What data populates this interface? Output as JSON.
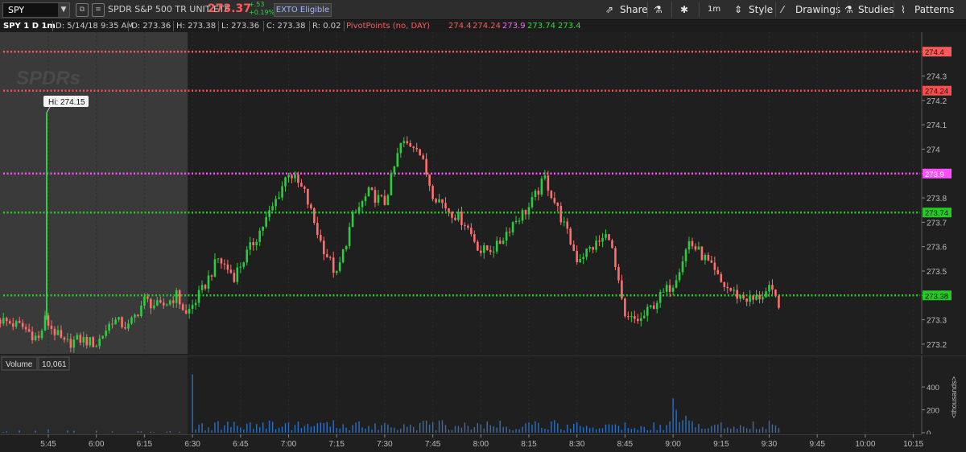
{
  "header": {
    "symbol": "SPY",
    "company": "SPDR S&P 500 TR UNIT ETF",
    "last": "273.37",
    "change": "+.53",
    "change_pct": "+0.19%",
    "eligibility": "EXTO Eligible",
    "share": "Share",
    "timeframe": "1m",
    "style": "Style",
    "drawings": "Drawings",
    "studies": "Studies",
    "patterns": "Patterns"
  },
  "info": {
    "chart_label": "SPY 1 D 1m",
    "date": "D: 5/14/18 9:35 AM",
    "open": "O: 273.36",
    "high": "H: 273.38",
    "low": "L: 273.36",
    "close": "C: 273.38",
    "range": "R: 0.02",
    "study": "PivotPoints (no, DAY)",
    "pivots": [
      "274.4",
      "274.24",
      "273.9",
      "273.74",
      "273.4"
    ]
  },
  "colors": {
    "background": "#1f1f1f",
    "premarket": "#3a3a3a",
    "up": "#2ecc40",
    "down": "#ff6e6e",
    "volume": "#2f6fbf",
    "r2": "#ff5a5a",
    "r1": "#ff4d4d",
    "pp": "#ff4dff",
    "s1": "#22cc22",
    "s2": "#22cc22"
  },
  "watermark": "SPDRs",
  "chart_data": {
    "type": "candlestick",
    "title": "SPY 1 D 1m",
    "x_ticks": [
      "5:45",
      "6:00",
      "6:15",
      "6:30",
      "6:45",
      "7:00",
      "7:15",
      "7:30",
      "7:45",
      "8:00",
      "8:15",
      "8:30",
      "8:45",
      "9:00",
      "9:15",
      "9:30",
      "9:45",
      "10:00",
      "10:15"
    ],
    "y_ticks": [
      "274.4",
      "274.3",
      "274.2",
      "274.1",
      "274",
      "273.9",
      "273.8",
      "273.7",
      "273.6",
      "273.5",
      "273.4",
      "273.3",
      "273.2"
    ],
    "ylim": [
      273.16,
      274.48
    ],
    "premarket_end": "6:30",
    "high_label": "Hi: 274.15",
    "pivot_lines": [
      {
        "name": "R2",
        "value": 274.4,
        "label": "274.4"
      },
      {
        "name": "R1",
        "value": 274.24,
        "label": "274.24"
      },
      {
        "name": "PP",
        "value": 273.9,
        "label": "273.9"
      },
      {
        "name": "S1",
        "value": 273.74,
        "label": "273.74"
      },
      {
        "name": "S2",
        "value": 273.4,
        "label": "273.38"
      }
    ],
    "price_anchors": [
      [
        "5:30",
        273.3
      ],
      [
        "5:37",
        273.27
      ],
      [
        "5:42",
        273.22
      ],
      [
        "5:44",
        273.3
      ],
      [
        "5:50",
        273.2
      ],
      [
        "5:55",
        273.22
      ],
      [
        "6:00",
        273.2
      ],
      [
        "6:05",
        273.3
      ],
      [
        "6:10",
        273.27
      ],
      [
        "6:15",
        273.38
      ],
      [
        "6:20",
        273.35
      ],
      [
        "6:25",
        273.4
      ],
      [
        "6:28",
        273.32
      ],
      [
        "6:33",
        273.42
      ],
      [
        "6:38",
        273.55
      ],
      [
        "6:43",
        273.48
      ],
      [
        "6:50",
        273.64
      ],
      [
        "6:55",
        273.76
      ],
      [
        "7:00",
        273.91
      ],
      [
        "7:05",
        273.82
      ],
      [
        "7:10",
        273.62
      ],
      [
        "7:15",
        273.48
      ],
      [
        "7:20",
        273.72
      ],
      [
        "7:25",
        273.82
      ],
      [
        "7:30",
        273.78
      ],
      [
        "7:35",
        274.02
      ],
      [
        "7:40",
        274.02
      ],
      [
        "7:45",
        273.82
      ],
      [
        "7:50",
        273.75
      ],
      [
        "7:55",
        273.7
      ],
      [
        "8:00",
        273.58
      ],
      [
        "8:05",
        273.6
      ],
      [
        "8:10",
        273.7
      ],
      [
        "8:15",
        273.76
      ],
      [
        "8:20",
        273.88
      ],
      [
        "8:25",
        273.72
      ],
      [
        "8:30",
        273.55
      ],
      [
        "8:35",
        273.6
      ],
      [
        "8:40",
        273.65
      ],
      [
        "8:45",
        273.3
      ],
      [
        "8:50",
        273.3
      ],
      [
        "8:55",
        273.38
      ],
      [
        "9:00",
        273.45
      ],
      [
        "9:05",
        273.62
      ],
      [
        "9:10",
        273.55
      ],
      [
        "9:15",
        273.45
      ],
      [
        "9:20",
        273.4
      ],
      [
        "9:25",
        273.38
      ],
      [
        "9:30",
        273.42
      ],
      [
        "9:33",
        273.37
      ]
    ],
    "volume": {
      "label": "Volume",
      "value": "10,061",
      "unit": "<thousands>",
      "y_ticks": [
        "400",
        "200",
        "0"
      ],
      "ylim": [
        0,
        520
      ],
      "spikes": [
        [
          "5:45",
          30
        ],
        [
          "6:30",
          510
        ],
        [
          "8:16",
          70
        ],
        [
          "8:17",
          100
        ],
        [
          "8:43",
          60
        ],
        [
          "9:00",
          300
        ],
        [
          "9:01",
          200
        ],
        [
          "9:15",
          90
        ]
      ]
    }
  }
}
